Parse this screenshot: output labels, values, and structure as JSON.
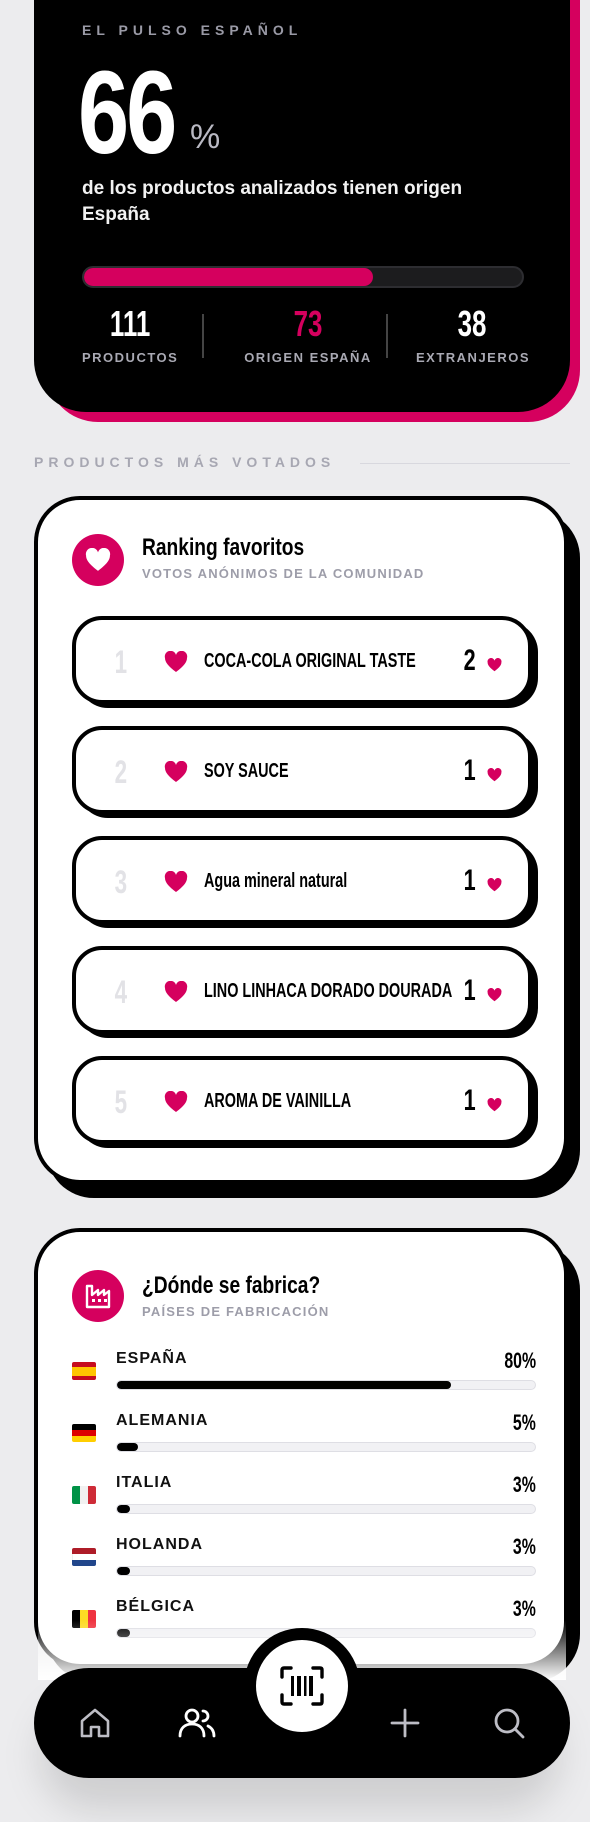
{
  "hero": {
    "label": "EL PULSO ESPAÑOL",
    "big_value": "66",
    "percent_sign": "%",
    "description": "de los productos analizados tienen origen España",
    "progress_fraction": 0.66,
    "stats": [
      {
        "value": "111",
        "label": "PRODUCTOS"
      },
      {
        "value": "73",
        "label": "ORIGEN ESPAÑA"
      },
      {
        "value": "38",
        "label": "EXTRANJEROS"
      }
    ]
  },
  "section": {
    "title": "PRODUCTOS MÁS VOTADOS"
  },
  "ranking": {
    "title": "Ranking favoritos",
    "subtitle": "VOTOS ANÓNIMOS DE LA COMUNIDAD",
    "icon": "heart-icon",
    "items": [
      {
        "rank": "1",
        "name": "COCA-COLA ORIGINAL TASTE",
        "votes": "2"
      },
      {
        "rank": "2",
        "name": "SOY SAUCE",
        "votes": "1"
      },
      {
        "rank": "3",
        "name": "Agua mineral natural",
        "votes": "1"
      },
      {
        "rank": "4",
        "name": "LINO LINHACA DORADO DOURADA",
        "votes": "1"
      },
      {
        "rank": "5",
        "name": "AROMA DE VAINILLA",
        "votes": "1"
      }
    ]
  },
  "countries": {
    "title": "¿Dónde se fabrica?",
    "subtitle": "PAÍSES DE FABRICACIÓN",
    "icon": "factory-icon",
    "items": [
      {
        "name": "ESPAÑA",
        "percent": "80%",
        "value": 80,
        "flag": "es"
      },
      {
        "name": "ALEMANIA",
        "percent": "5%",
        "value": 5,
        "flag": "de"
      },
      {
        "name": "ITALIA",
        "percent": "3%",
        "value": 3,
        "flag": "it"
      },
      {
        "name": "HOLANDA",
        "percent": "3%",
        "value": 3,
        "flag": "nl"
      },
      {
        "name": "BÉLGICA",
        "percent": "3%",
        "value": 3,
        "flag": "be"
      }
    ]
  },
  "nav": {
    "items": [
      "home-icon",
      "users-icon",
      "barcode-scan-icon",
      "plus-icon",
      "search-icon"
    ]
  },
  "colors": {
    "accent": "#d5005e",
    "black": "#000000",
    "background": "#ececee"
  }
}
